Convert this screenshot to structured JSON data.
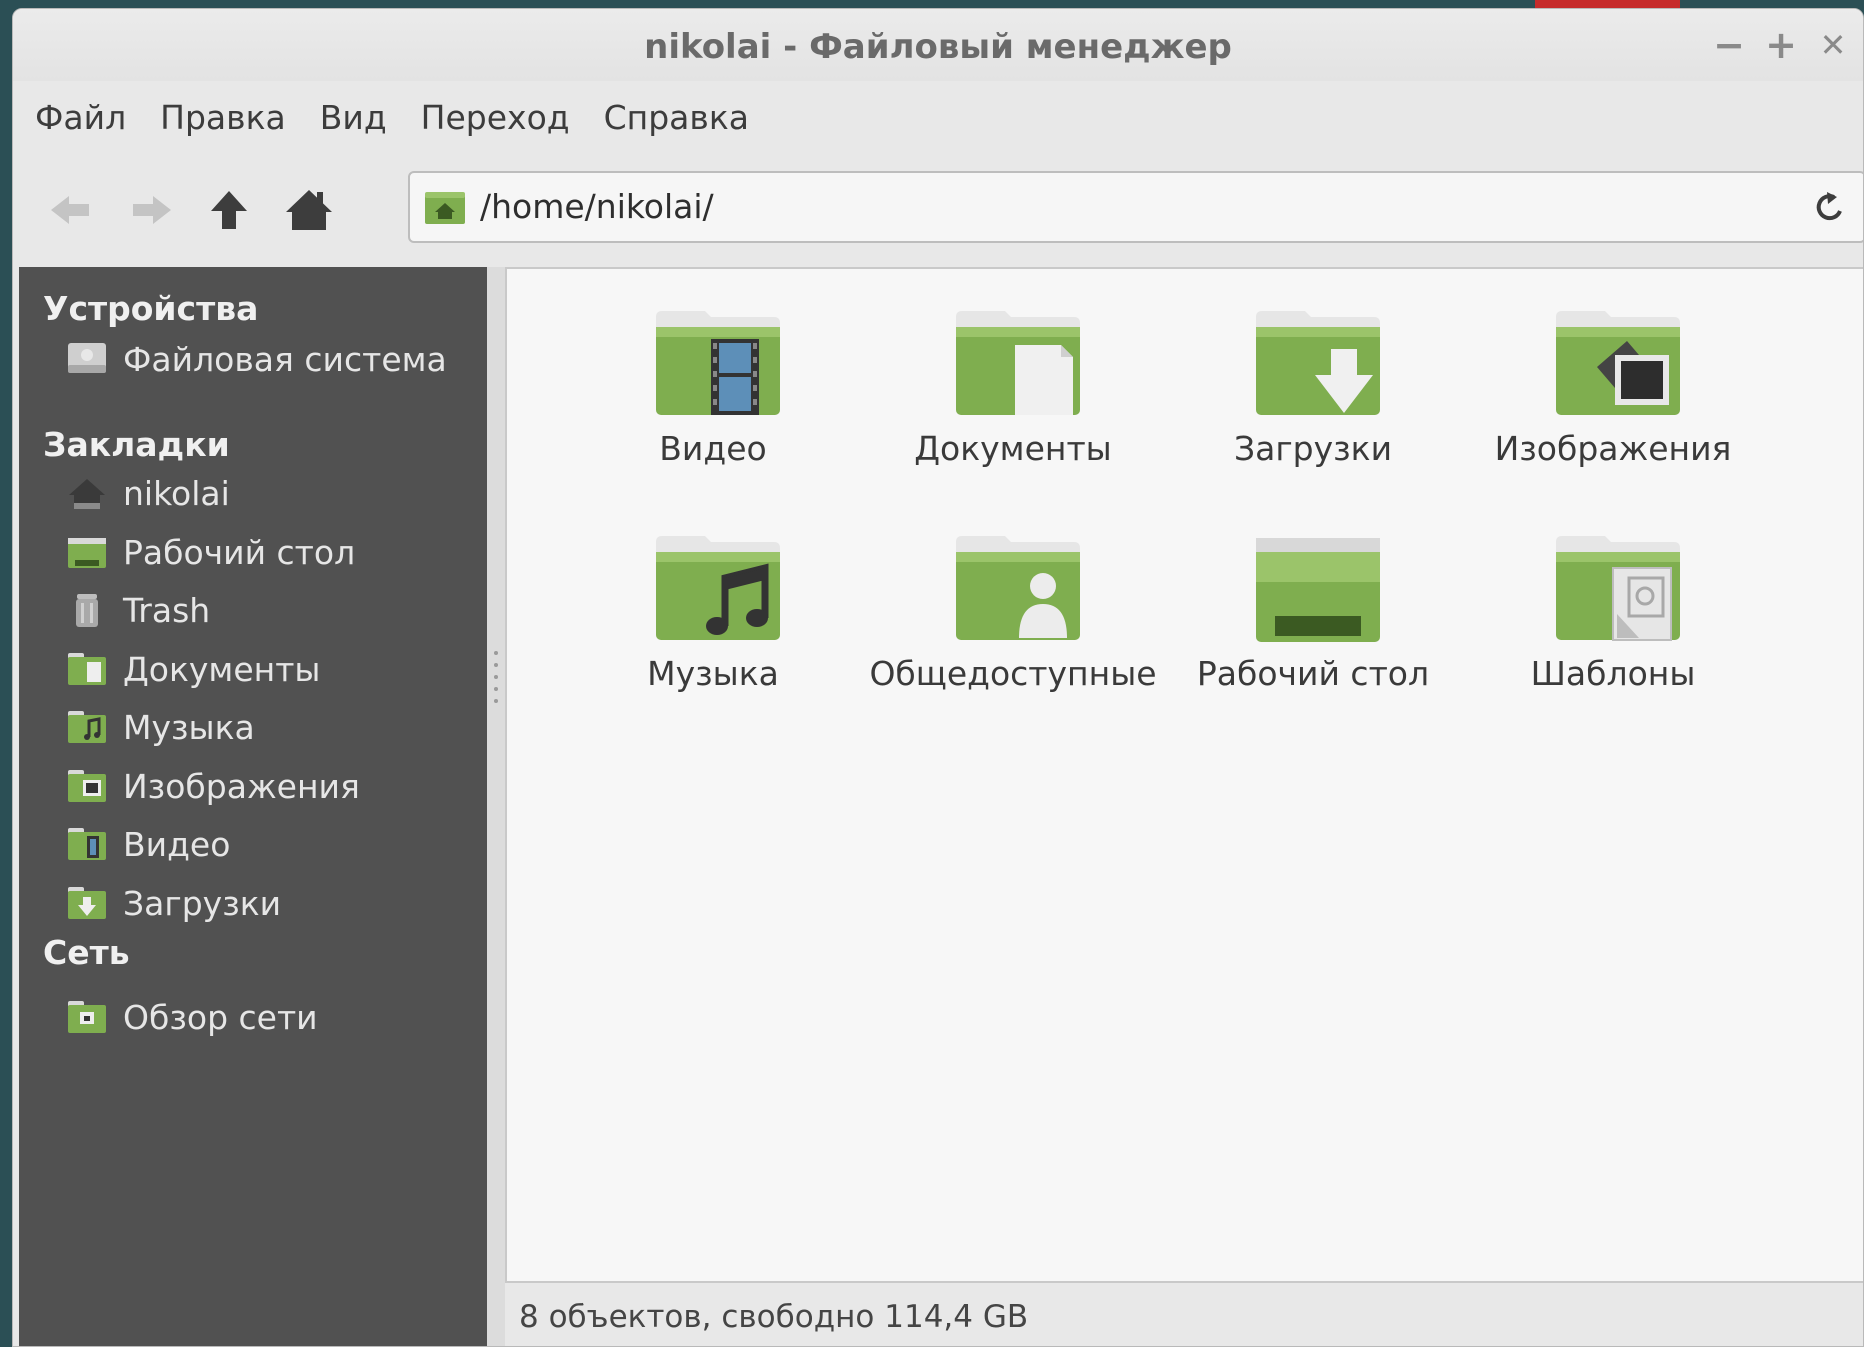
{
  "window": {
    "title": "nikolai - Файловый менеджер",
    "controls": {
      "minimize": "−",
      "maximize": "+",
      "close": "✕"
    }
  },
  "menu": [
    "Файл",
    "Правка",
    "Вид",
    "Переход",
    "Справка"
  ],
  "toolbar": {
    "back_icon": "arrow-left-icon",
    "forward_icon": "arrow-right-icon",
    "up_icon": "arrow-up-icon",
    "home_icon": "home-icon",
    "reload_icon": "reload-icon"
  },
  "location": {
    "path": "/home/nikolai/"
  },
  "sidebar": {
    "devices": {
      "heading": "Устройства",
      "items": [
        {
          "label": "Файловая система",
          "icon": "drive-icon"
        }
      ]
    },
    "bookmarks": {
      "heading": "Закладки",
      "items": [
        {
          "label": "nikolai",
          "icon": "home-icon"
        },
        {
          "label": "Рабочий стол",
          "icon": "desktop-icon"
        },
        {
          "label": "Trash",
          "icon": "trash-icon"
        },
        {
          "label": "Документы",
          "icon": "folder-documents-icon"
        },
        {
          "label": "Музыка",
          "icon": "folder-music-icon"
        },
        {
          "label": "Изображения",
          "icon": "folder-pictures-icon"
        },
        {
          "label": "Видео",
          "icon": "folder-videos-icon"
        },
        {
          "label": "Загрузки",
          "icon": "folder-downloads-icon"
        }
      ]
    },
    "network": {
      "heading": "Сеть",
      "items": [
        {
          "label": "Обзор сети",
          "icon": "network-folder-icon"
        }
      ]
    }
  },
  "files": [
    {
      "label": "Видео",
      "icon": "folder-videos-icon"
    },
    {
      "label": "Документы",
      "icon": "folder-documents-icon"
    },
    {
      "label": "Загрузки",
      "icon": "folder-downloads-icon"
    },
    {
      "label": "Изображения",
      "icon": "folder-pictures-icon"
    },
    {
      "label": "Музыка",
      "icon": "folder-music-icon"
    },
    {
      "label": "Общедоступные",
      "icon": "folder-public-icon"
    },
    {
      "label": "Рабочий стол",
      "icon": "desktop-folder-icon"
    },
    {
      "label": "Шаблоны",
      "icon": "folder-templates-icon"
    }
  ],
  "status": "8 объектов, свободно 114,4 GB",
  "colors": {
    "folder_green": "#7fae4f",
    "sidebar_bg": "#515151",
    "content_bg": "#f7f7f7"
  }
}
